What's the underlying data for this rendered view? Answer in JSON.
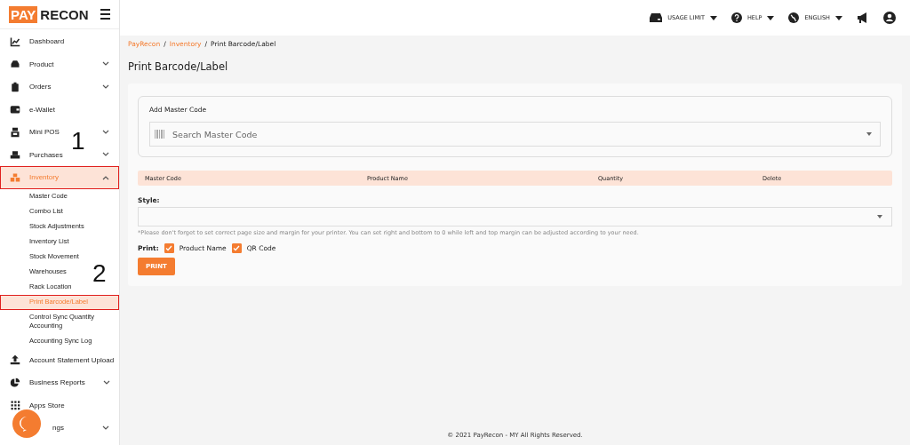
{
  "logo": {
    "part_1": "PAY",
    "part_2": "RECON"
  },
  "topbar": {
    "items": [
      {
        "label": "USAGE LIMIT",
        "dropdown": true
      },
      {
        "label": "HELP",
        "dropdown": true
      },
      {
        "label": "ENGLISH",
        "dropdown": true
      }
    ]
  },
  "sidebar": {
    "items": [
      {
        "label": "Dashboard",
        "kind": "link",
        "selected": false,
        "outlined": false
      },
      {
        "label": "Product",
        "kind": "group",
        "expanded": false,
        "selected": false,
        "outlined": false
      },
      {
        "label": "Orders",
        "kind": "group",
        "expanded": false,
        "selected": false,
        "outlined": false
      },
      {
        "label": "e-Wallet",
        "kind": "link",
        "selected": false,
        "outlined": false
      },
      {
        "label": "Mini POS",
        "kind": "group",
        "expanded": false,
        "selected": false,
        "outlined": false
      },
      {
        "label": "Purchases",
        "kind": "group",
        "expanded": false,
        "selected": false,
        "outlined": false
      },
      {
        "label": "Inventory",
        "kind": "group",
        "expanded": true,
        "selected": true,
        "outlined": true,
        "children": [
          {
            "label": "Master Code",
            "selected": false,
            "outlined": false
          },
          {
            "label": "Combo List",
            "selected": false,
            "outlined": false
          },
          {
            "label": "Stock Adjustments",
            "selected": false,
            "outlined": false
          },
          {
            "label": "Inventory List",
            "selected": false,
            "outlined": false
          },
          {
            "label": "Stock Movement",
            "selected": false,
            "outlined": false
          },
          {
            "label": "Warehouses",
            "selected": false,
            "outlined": false
          },
          {
            "label": "Rack Location",
            "selected": false,
            "outlined": false
          },
          {
            "label": "Print Barcode/Label",
            "selected": true,
            "outlined": true
          },
          {
            "label": "Control Sync Quantity Accounting",
            "selected": false,
            "outlined": false
          },
          {
            "label": "Accounting Sync Log",
            "selected": false,
            "outlined": false
          }
        ]
      },
      {
        "label": "Account Statement Upload",
        "kind": "link",
        "selected": false,
        "outlined": false
      },
      {
        "label": "Business Reports",
        "kind": "group",
        "expanded": false,
        "selected": false,
        "outlined": false
      },
      {
        "label": "Apps Store",
        "kind": "link",
        "selected": false,
        "outlined": false
      },
      {
        "label": "ngs",
        "kind": "group",
        "expanded": false,
        "selected": false,
        "outlined": false
      }
    ]
  },
  "annotations": [
    "1",
    "2"
  ],
  "breadcrumb": [
    {
      "label": "PayRecon",
      "link": true
    },
    {
      "separator": "/",
      "label": "Inventory",
      "link": true
    },
    {
      "separator": "/",
      "label": "Print Barcode/Label",
      "link": false
    }
  ],
  "page_title": "Print Barcode/Label",
  "master_code": {
    "label": "Add Master Code",
    "placeholder": "Search Master Code"
  },
  "table": {
    "columns": [
      "Master Code",
      "Product Name",
      "Quantity",
      "Delete"
    ]
  },
  "style": {
    "label": "Style:",
    "note": "*Please don't forget to set correct page size and margin for your printer. You can set right and bottom to 0 while left and top margin can be adjusted according to your need."
  },
  "print": {
    "label": "Print:",
    "options": [
      {
        "label": "Product Name",
        "checked": true
      },
      {
        "label": "QR Code",
        "checked": true
      }
    ],
    "button": "PRINT"
  },
  "footer": "© 2021 PayRecon - MY All Rights Reserved."
}
